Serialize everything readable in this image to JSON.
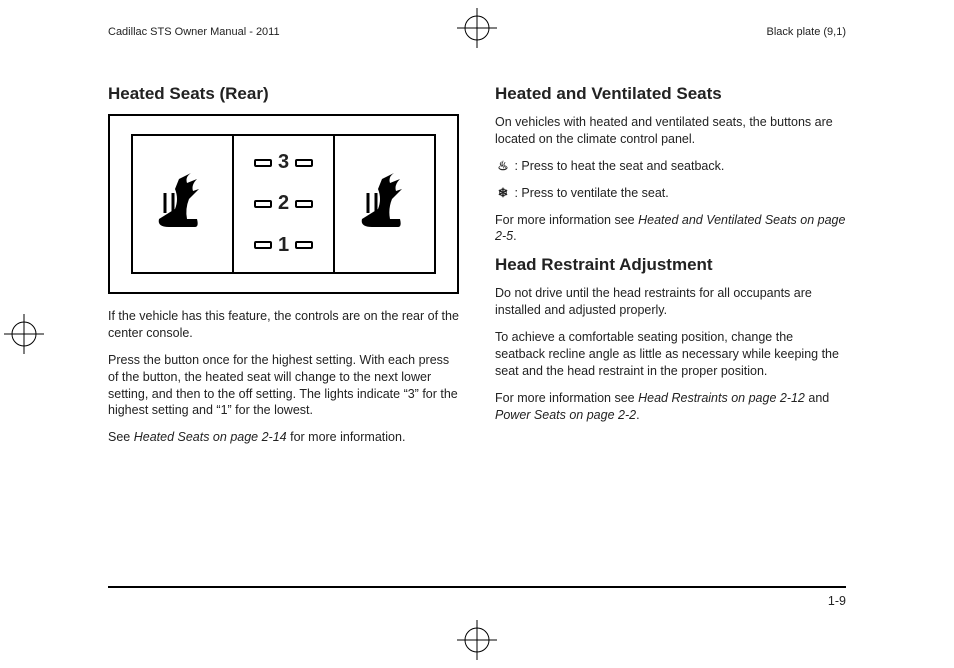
{
  "header": {
    "left": "Cadillac STS Owner Manual - 2011",
    "right": "Black plate (9,1)"
  },
  "left": {
    "h1": "Heated Seats (Rear)",
    "fig": {
      "n3": "3",
      "n2": "2",
      "n1": "1"
    },
    "p1": "If the vehicle has this feature, the controls are on the rear of the center console.",
    "p2": "Press the button once for the highest setting. With each press of the button, the heated seat will change to the next lower setting, and then to the off setting. The lights indicate “3” for the highest setting and “1” for the lowest.",
    "p3a": "See ",
    "p3i": "Heated Seats on page 2-14",
    "p3b": " for more information."
  },
  "right": {
    "h1": "Heated and Ventilated Seats",
    "p1": "On vehicles with heated and ventilated seats, the buttons are located on the climate control panel.",
    "p2sym": "♨",
    "p2": " : Press to heat the seat and seatback.",
    "p3sym": "❄",
    "p3": " : Press to ventilate the seat.",
    "p4a": "For more information see ",
    "p4i": "Heated and Ventilated Seats on page 2-5",
    "p4b": ".",
    "h2": "Head Restraint Adjustment",
    "p5": "Do not drive until the head restraints for all occupants are installed and adjusted properly.",
    "p6": "To achieve a comfortable seating position, change the seatback recline angle as little as necessary while keeping the seat and the head restraint in the proper position.",
    "p7a": "For more information see ",
    "p7i1": "Head Restraints on page 2-12",
    "p7m": " and ",
    "p7i2": "Power Seats on page 2-2",
    "p7b": "."
  },
  "footer": {
    "page": "1-9"
  }
}
